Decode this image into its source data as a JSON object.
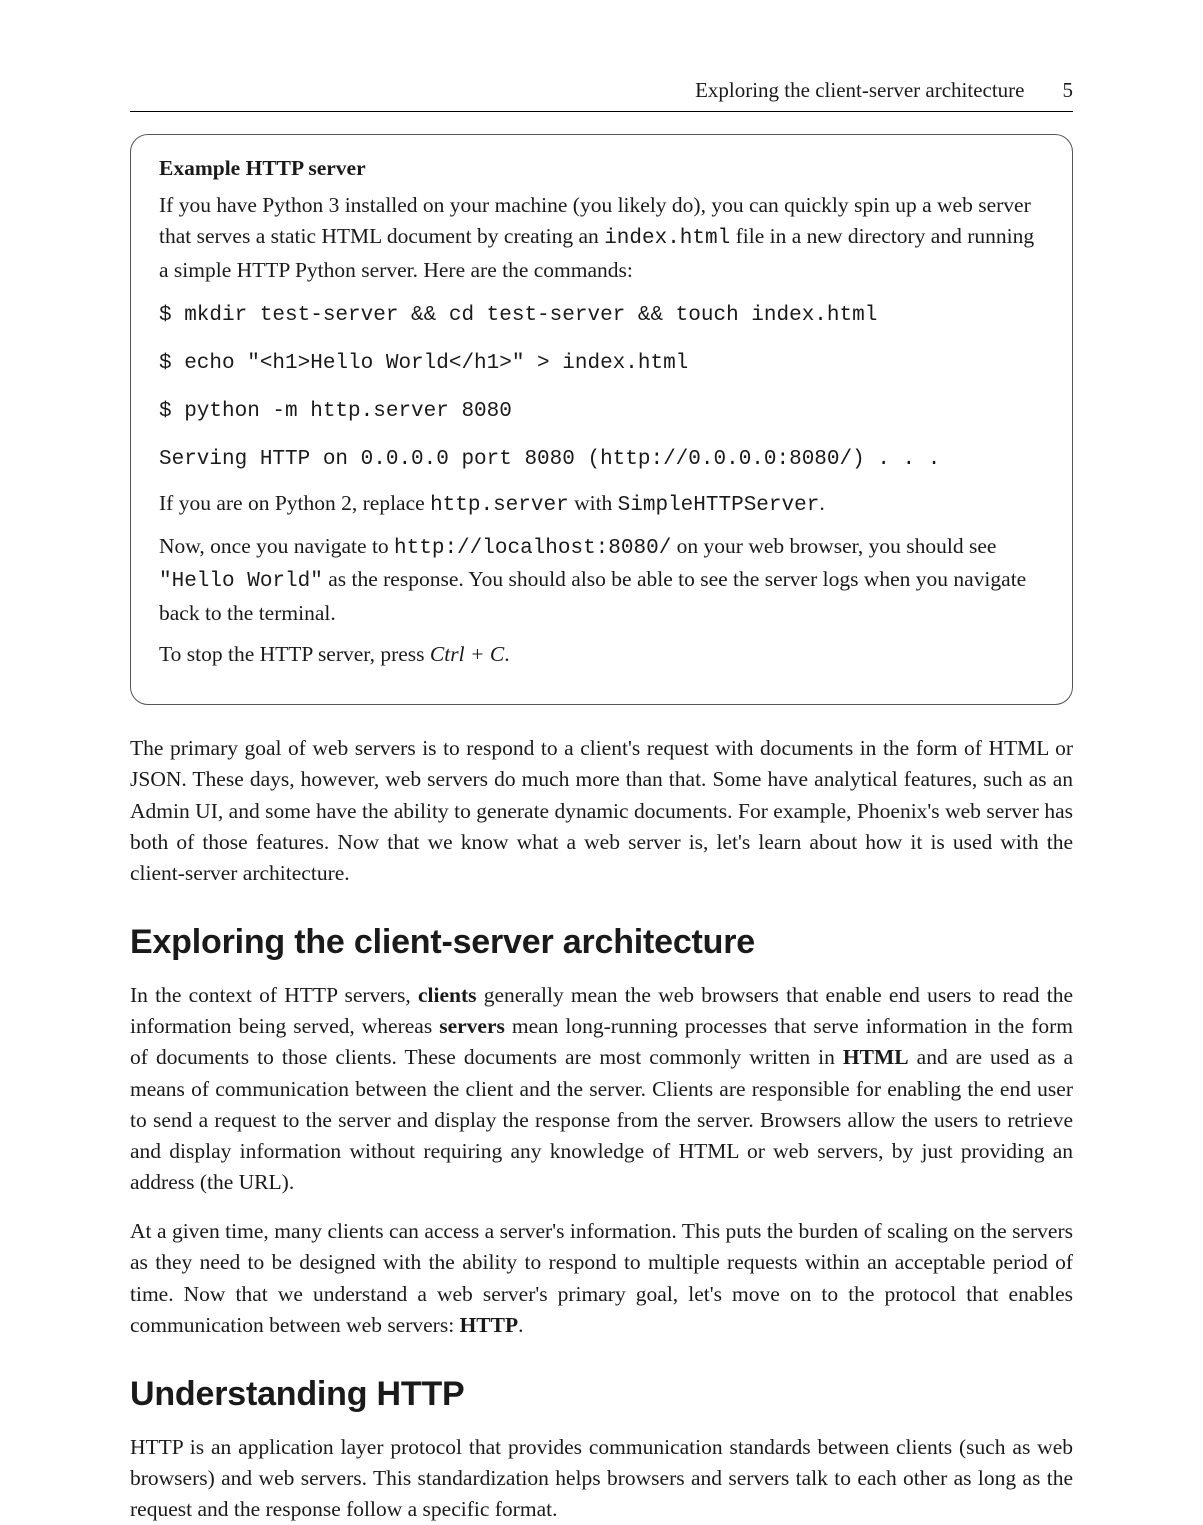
{
  "header": {
    "running_title": "Exploring the client-server architecture",
    "page_number": "5"
  },
  "callout": {
    "title": "Example HTTP server",
    "intro_a": "If you have Python 3 installed on your machine (you likely do), you can quickly spin up a web server that serves a static HTML document by creating an ",
    "intro_code": "index.html",
    "intro_b": " file in a new directory and running a simple HTTP Python server. Here are the commands:",
    "code_lines": [
      "$ mkdir test-server && cd test-server && touch index.html",
      "$ echo \"<h1>Hello World</h1>\" > index.html",
      "$ python -m http.server 8080",
      "Serving HTTP on 0.0.0.0 port 8080 (http://0.0.0.0:8080/) . . ."
    ],
    "py2_a": "If you are on Python 2, replace ",
    "py2_code1": "http.server",
    "py2_b": " with ",
    "py2_code2": "SimpleHTTPServer",
    "py2_c": ".",
    "nav_a": "Now, once you navigate to ",
    "nav_code1": "http://localhost:8080/",
    "nav_b": " on your web browser, you should see ",
    "nav_code2": "\"Hello World\"",
    "nav_c": " as the response. You should also be able to see the server logs when you navigate back to the terminal.",
    "stop_a": "To stop the HTTP server, press ",
    "stop_key": "Ctrl + C",
    "stop_b": "."
  },
  "para_primary_goal": "The primary goal of web servers is to respond to a client's request with documents in the form of HTML or JSON. These days, however, web servers do much more than that. Some have analytical features, such as an Admin UI, and some have the ability to generate dynamic documents. For example, Phoenix's web server has both of those features. Now that we know what a web server is, let's learn about how it is used with the client-server architecture.",
  "section1_title": "Exploring the client-server architecture",
  "section1_p1": {
    "a": "In the context of HTTP servers, ",
    "b_bold": "clients",
    "c": " generally mean the web browsers that enable end users to read the information being served, whereas ",
    "d_bold": "servers",
    "e": " mean long-running processes that serve information in the form of documents to those clients. These documents are most commonly written in ",
    "f_bold": "HTML",
    "g": " and are used as a means of communication between the client and the server. Clients are responsible for enabling the end user to send a request to the server and display the response from the server. Browsers allow the users to retrieve and display information without requiring any knowledge of HTML or web servers, by just providing an address (the URL)."
  },
  "section1_p2": {
    "a": "At a given time, many clients can access a server's information. This puts the burden of scaling on the servers as they need to be designed with the ability to respond to multiple requests within an acceptable period of time. Now that we understand a web server's primary goal, let's move on to the protocol that enables communication between web servers: ",
    "b_bold": "HTTP",
    "c": "."
  },
  "section2_title": "Understanding HTTP",
  "section2_p1": "HTTP is an application layer protocol that provides communication standards between clients (such as web browsers) and web servers. This standardization helps browsers and servers talk to each other as long as the request and the response follow a specific format."
}
